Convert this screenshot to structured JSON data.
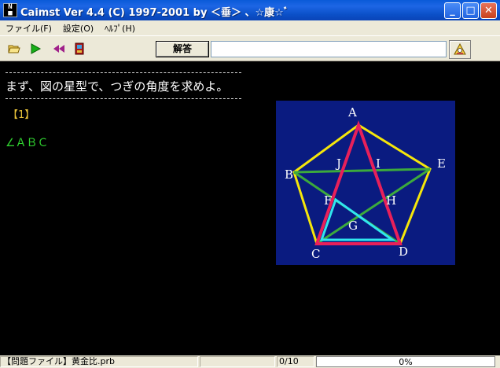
{
  "window": {
    "title": "Caimst Ver 4.4 (C) 1997-2001  by ＜垂＞ 、☆康☆ﾞ",
    "icon": "app-icon",
    "icon_text": "NG\n■",
    "controls": {
      "minimize": "minimize-icon",
      "maximize": "maximize-icon",
      "close": "close-icon"
    }
  },
  "menu": {
    "items": [
      {
        "label": "ファイル(F)"
      },
      {
        "label": "設定(O)"
      },
      {
        "label": "ﾍﾙﾌﾟ(H)"
      }
    ]
  },
  "toolbar": {
    "open_icon": "open-folder-icon",
    "play_icon": "play-icon",
    "rewind_icon": "rewind-icon",
    "exit_icon": "exit-door-icon",
    "answer_label": "解答",
    "answer_value": "",
    "hint_icon": "hint-icon"
  },
  "content": {
    "question": "まず、図の星型で、つぎの角度を求めよ。",
    "number": "【1】",
    "expression": "∠ＡＢＣ",
    "figure": {
      "background": "#0a1b80",
      "points": {
        "A": "A",
        "B": "B",
        "C": "C",
        "D": "D",
        "E": "E",
        "F": "F",
        "G": "G",
        "H": "H",
        "I": "I",
        "J": "J"
      },
      "colors": {
        "pentagon": "#f5e60a",
        "star": "#3caa3c",
        "highlight_triangle": "#e8205a",
        "inner_triangle": "#30e6ee"
      }
    }
  },
  "status": {
    "file": "【問題ファイル】黄金比.prb",
    "blank": "",
    "count": "0/10",
    "progress_text": "0%",
    "progress_value": 0
  }
}
